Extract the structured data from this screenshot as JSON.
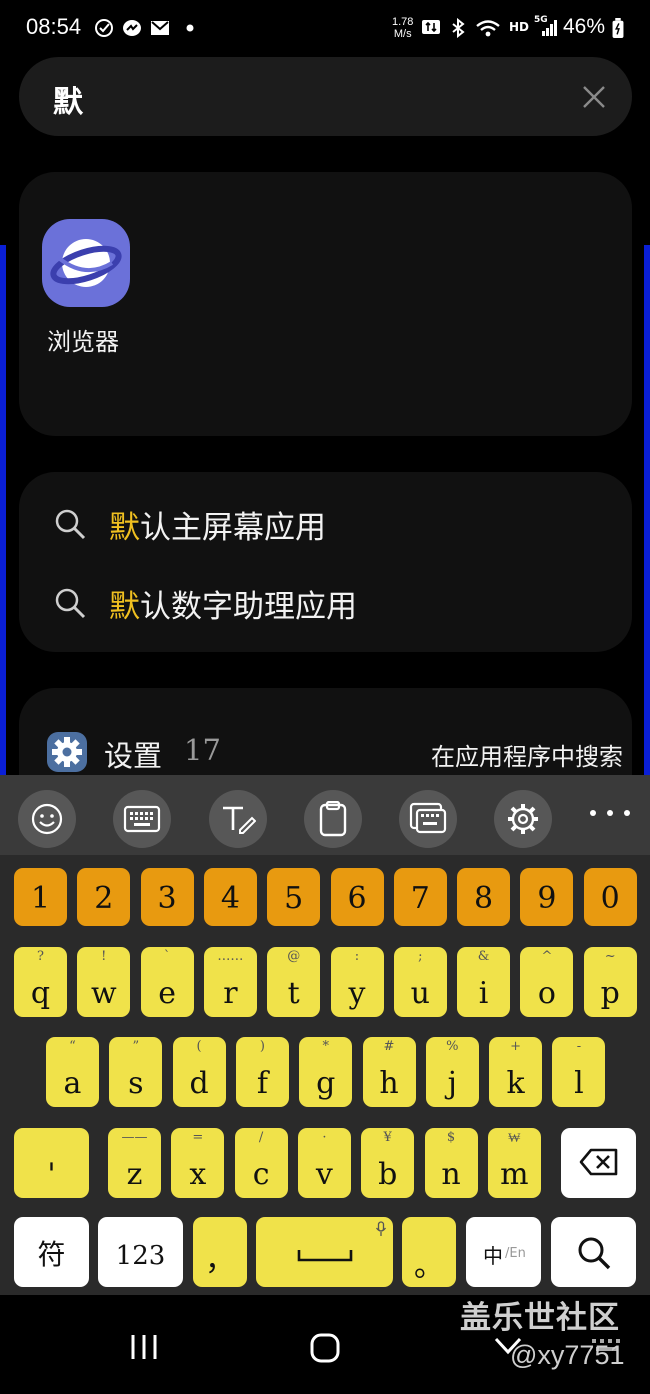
{
  "status_bar": {
    "time": "08:54",
    "net_speed_value": "1.78",
    "net_speed_unit": "M/s",
    "hd": "HD",
    "signal_label": "5G",
    "battery": "46%"
  },
  "search": {
    "query": "默"
  },
  "apps": [
    {
      "label": "浏览器",
      "icon": "samsung-internet-icon"
    }
  ],
  "suggestions": [
    {
      "highlight": "默",
      "rest": "认主屏幕应用"
    },
    {
      "highlight": "默",
      "rest": "认数字助理应用"
    }
  ],
  "settings_result": {
    "app_name": "设置",
    "count": "17",
    "action": "在应用程序中搜索"
  },
  "toolbar": {
    "buttons": [
      "emoji-icon",
      "keyboard-icon",
      "handwriting-icon",
      "clipboard-icon",
      "one-handed-keyboard-icon",
      "settings-icon",
      "more-icon"
    ]
  },
  "keyboard": {
    "numbers": [
      "1",
      "2",
      "3",
      "4",
      "5",
      "6",
      "7",
      "8",
      "9",
      "0"
    ],
    "row1": [
      {
        "k": "q",
        "s": "?"
      },
      {
        "k": "w",
        "s": "!"
      },
      {
        "k": "e",
        "s": "`"
      },
      {
        "k": "r",
        "s": "……"
      },
      {
        "k": "t",
        "s": "@"
      },
      {
        "k": "y",
        "s": ":"
      },
      {
        "k": "u",
        "s": ";"
      },
      {
        "k": "i",
        "s": "&"
      },
      {
        "k": "o",
        "s": "^"
      },
      {
        "k": "p",
        "s": "~"
      }
    ],
    "row2": [
      {
        "k": "a",
        "s": "“"
      },
      {
        "k": "s",
        "s": "”"
      },
      {
        "k": "d",
        "s": "("
      },
      {
        "k": "f",
        "s": ")"
      },
      {
        "k": "g",
        "s": "*"
      },
      {
        "k": "h",
        "s": "#"
      },
      {
        "k": "j",
        "s": "%"
      },
      {
        "k": "k",
        "s": "+"
      },
      {
        "k": "l",
        "s": "-"
      }
    ],
    "row3": [
      {
        "k": "'",
        "s": ""
      },
      {
        "k": "z",
        "s": "——"
      },
      {
        "k": "x",
        "s": "="
      },
      {
        "k": "c",
        "s": "/"
      },
      {
        "k": "v",
        "s": "·"
      },
      {
        "k": "b",
        "s": "¥"
      },
      {
        "k": "n",
        "s": "$"
      },
      {
        "k": "m",
        "s": "₩"
      }
    ],
    "symbols_label": "符",
    "numbers_label": "123",
    "comma": "，",
    "period": "。",
    "lang_main": "中",
    "lang_alt": "/En"
  },
  "watermark": {
    "line1": "盖乐世社区",
    "line2": "@xy7751"
  },
  "colors": {
    "number_keys": "#e89a10",
    "letter_keys": "#f0e24a",
    "highlight_text": "#f0c020",
    "edge_accent": "#0a1fd6"
  }
}
